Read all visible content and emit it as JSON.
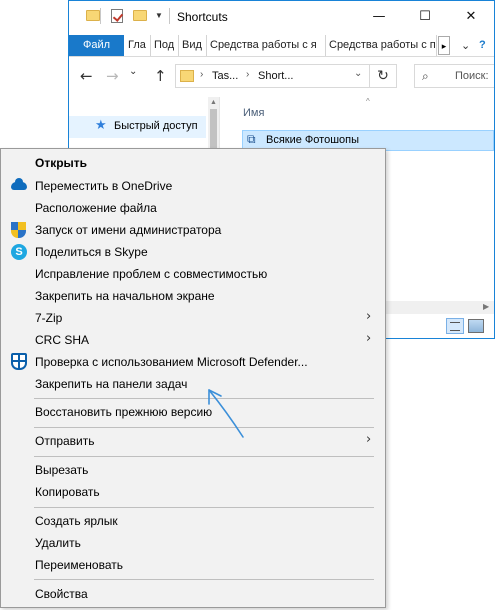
{
  "window": {
    "title": "Shortcuts",
    "controls": {
      "minimize": "—",
      "maximize": "☐",
      "close": "✕"
    }
  },
  "ribbon": {
    "tabs": [
      {
        "label": "Файл"
      },
      {
        "label": "Гла"
      },
      {
        "label": "Под"
      },
      {
        "label": "Вид"
      },
      {
        "label": "Средства работы с я"
      },
      {
        "label": "Средства работы с п"
      }
    ],
    "more": "▸",
    "expand": "⌄",
    "help": "?"
  },
  "addressbar": {
    "back": "←",
    "forward": "→",
    "recent": "⌄",
    "up": "↑",
    "crumbs": [
      "Tas...",
      "Short..."
    ],
    "separator": "›",
    "dropdown": "⌄",
    "refresh": "↻",
    "search_placeholder": "Поиск:"
  },
  "navpane": {
    "quick_access": "Быстрый доступ"
  },
  "content": {
    "column_name": "Имя",
    "sort_indicator": "^",
    "file": "Всякие Фотошопы"
  },
  "context_menu": {
    "items": [
      {
        "label": "Открыть",
        "icon": "",
        "bold": true,
        "submenu": false
      },
      {
        "label": "Переместить в OneDrive",
        "icon": "onedrive-icon",
        "submenu": false
      },
      {
        "label": "Расположение файла",
        "icon": "",
        "submenu": false
      },
      {
        "label": "Запуск от имени администратора",
        "icon": "uac-shield-icon",
        "submenu": false
      },
      {
        "label": "Поделиться в Skype",
        "icon": "skype-icon",
        "submenu": false
      },
      {
        "label": "Исправление проблем с совместимостью",
        "icon": "",
        "submenu": false
      },
      {
        "label": "Закрепить на начальном экране",
        "icon": "",
        "submenu": false
      },
      {
        "label": "7-Zip",
        "icon": "",
        "submenu": true
      },
      {
        "label": "CRC SHA",
        "icon": "",
        "submenu": true
      },
      {
        "label": "Проверка с использованием Microsoft Defender...",
        "icon": "defender-icon",
        "submenu": false
      },
      {
        "label": "Закрепить на панели задач",
        "icon": "",
        "submenu": false
      },
      {
        "label": "Восстановить прежнюю версию",
        "icon": "",
        "submenu": false
      },
      {
        "label": "Отправить",
        "icon": "",
        "submenu": true
      },
      {
        "label": "Вырезать",
        "icon": "",
        "submenu": false
      },
      {
        "label": "Копировать",
        "icon": "",
        "submenu": false
      },
      {
        "label": "Создать ярлык",
        "icon": "",
        "submenu": false
      },
      {
        "label": "Удалить",
        "icon": "",
        "submenu": false
      },
      {
        "label": "Переименовать",
        "icon": "",
        "submenu": false
      },
      {
        "label": "Свойства",
        "icon": "",
        "submenu": false
      }
    ],
    "submenu_arrow": "›"
  },
  "annotation": {
    "color": "#3b8fd9"
  }
}
